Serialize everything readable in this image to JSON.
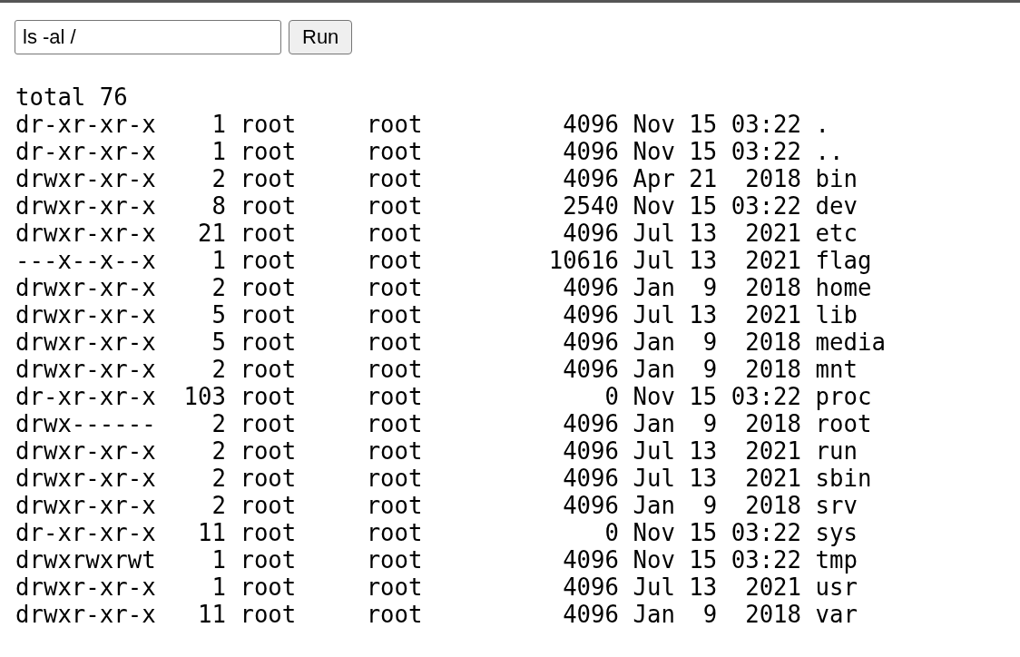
{
  "command": {
    "value": "ls -al /"
  },
  "run_button": {
    "label": "Run"
  },
  "output_lines": [
    "total 76",
    "dr-xr-xr-x    1 root     root          4096 Nov 15 03:22 .",
    "dr-xr-xr-x    1 root     root          4096 Nov 15 03:22 ..",
    "drwxr-xr-x    2 root     root          4096 Apr 21  2018 bin",
    "drwxr-xr-x    8 root     root          2540 Nov 15 03:22 dev",
    "drwxr-xr-x   21 root     root          4096 Jul 13  2021 etc",
    "---x--x--x    1 root     root         10616 Jul 13  2021 flag",
    "drwxr-xr-x    2 root     root          4096 Jan  9  2018 home",
    "drwxr-xr-x    5 root     root          4096 Jul 13  2021 lib",
    "drwxr-xr-x    5 root     root          4096 Jan  9  2018 media",
    "drwxr-xr-x    2 root     root          4096 Jan  9  2018 mnt",
    "dr-xr-xr-x  103 root     root             0 Nov 15 03:22 proc",
    "drwx------    2 root     root          4096 Jan  9  2018 root",
    "drwxr-xr-x    2 root     root          4096 Jul 13  2021 run",
    "drwxr-xr-x    2 root     root          4096 Jul 13  2021 sbin",
    "drwxr-xr-x    2 root     root          4096 Jan  9  2018 srv",
    "dr-xr-xr-x   11 root     root             0 Nov 15 03:22 sys",
    "drwxrwxrwt    1 root     root          4096 Nov 15 03:22 tmp",
    "drwxr-xr-x    1 root     root          4096 Jul 13  2021 usr",
    "drwxr-xr-x   11 root     root          4096 Jan  9  2018 var"
  ]
}
